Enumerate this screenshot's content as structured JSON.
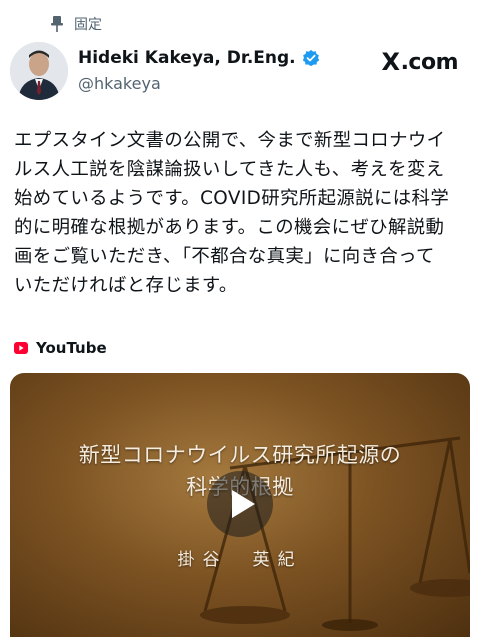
{
  "pinned": {
    "label": "固定",
    "icon": "pin-icon"
  },
  "author": {
    "name": "Hideki Kakeya, Dr.Eng.",
    "handle": "@hkakeya",
    "verified": true,
    "verified_color": "#1d9bf0",
    "avatar_icon": "avatar"
  },
  "source": {
    "brand": "X",
    "suffix": ".com"
  },
  "post": {
    "lines": [
      "エプスタイン文書の公開で、今まで新型コロナウイ",
      "ルス人工説を陰謀論扱いしてきた人も、考えを変え",
      "始めているようです。COVID研究所起源説には科学",
      "的に明確な根拠があります。この機会にぜひ解説動",
      "画をご覧いただき、「不都合な真実」に向き合って",
      "いただければと存じます。"
    ]
  },
  "link_card": {
    "provider": "YouTube",
    "provider_color": "#ff0033",
    "video_title_lines": [
      "新型コロナウイルス研究所起源の",
      "科学的根拠"
    ],
    "video_author": "掛谷　英紀",
    "play_icon": "play-icon"
  }
}
